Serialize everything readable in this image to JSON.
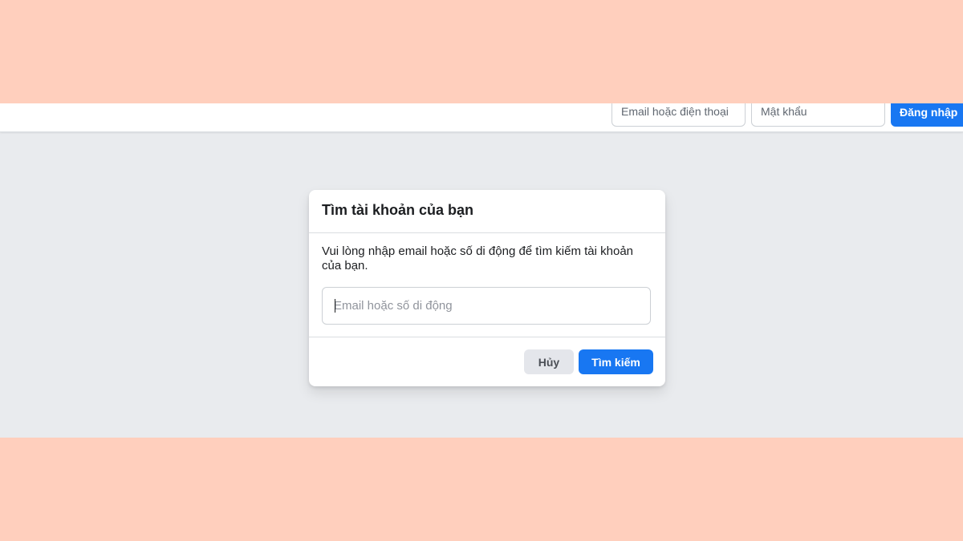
{
  "header": {
    "email_placeholder": "Email hoặc điện thoại",
    "password_placeholder": "Mật khẩu",
    "login_label": "Đăng nhập"
  },
  "dialog": {
    "title": "Tìm tài khoản của bạn",
    "description": "Vui lòng nhập email hoặc số di động để tìm kiếm tài khoản của bạn.",
    "search_placeholder": "Email hoặc số di động",
    "search_value": "",
    "cancel_label": "Hủy",
    "search_label": "Tìm kiếm"
  },
  "colors": {
    "accent": "#1877f2",
    "page_background": "#e9ebee",
    "frame_background": "#ffcfbd"
  }
}
